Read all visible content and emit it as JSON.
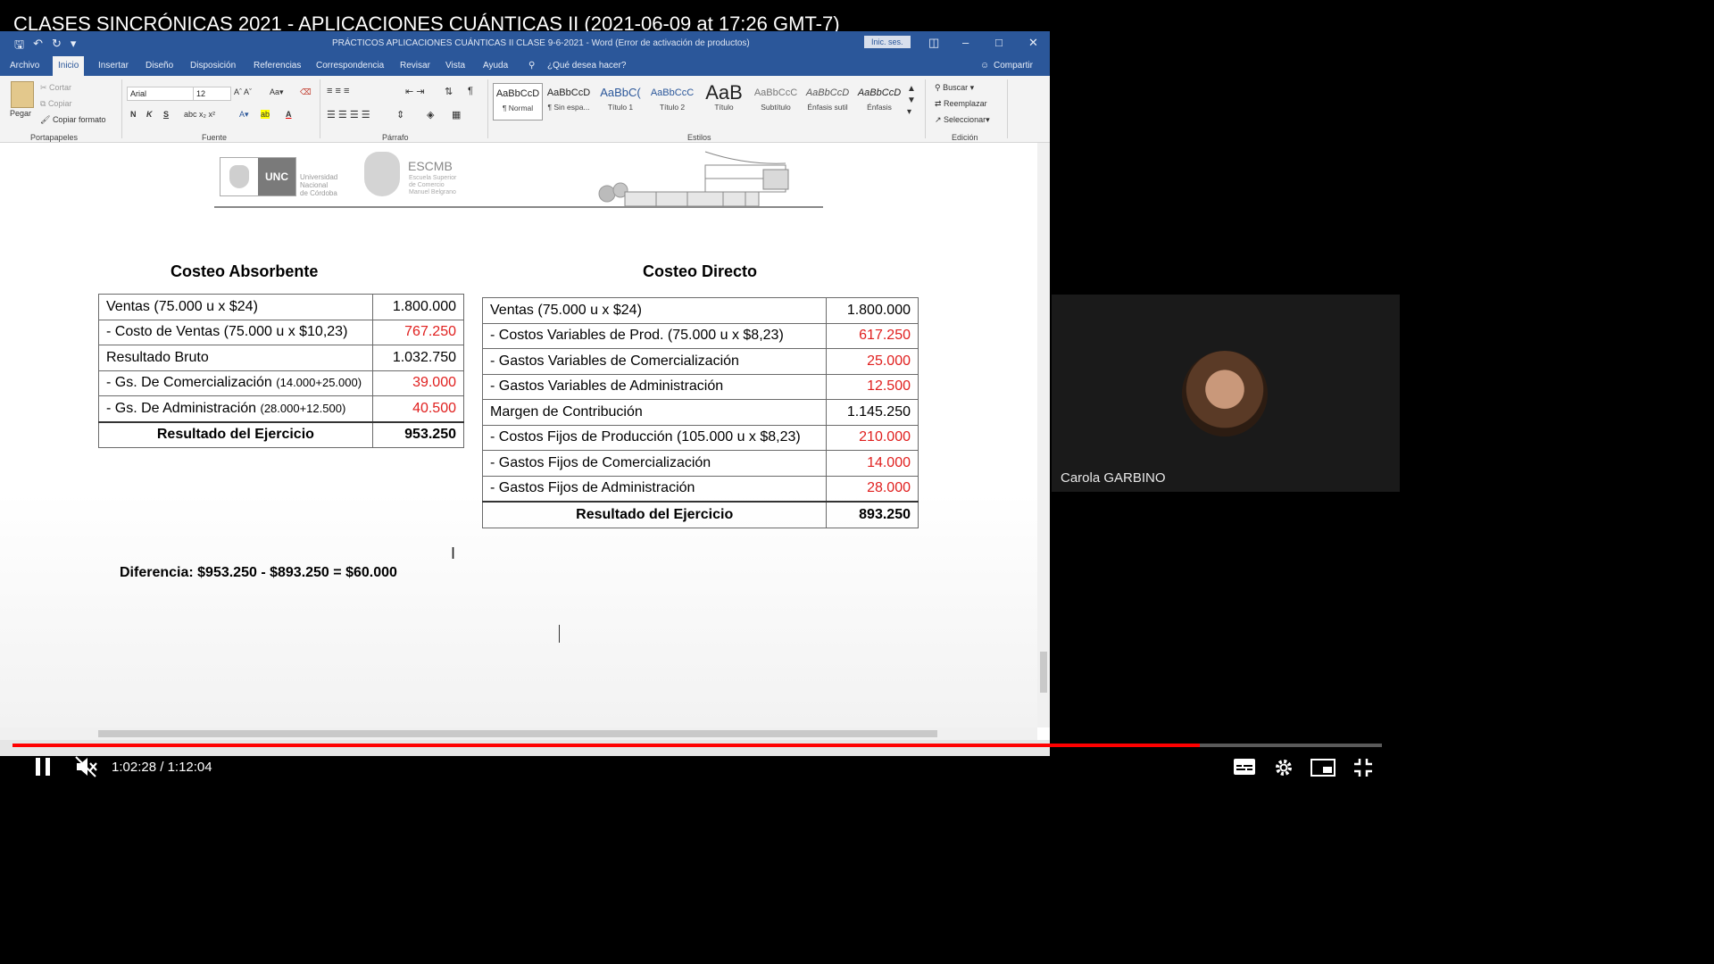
{
  "video": {
    "title": "CLASES SINCRÓNICAS 2021 - APLICACIONES CUÁNTICAS II (2021-06-09 at 17:26 GMT-7)",
    "time_current": "1:02:28",
    "time_sep": " / ",
    "time_total": "1:12:04",
    "progress": 0.867
  },
  "word": {
    "doc_title": "PRÁCTICOS APLICACIONES CUÁNTICAS II  CLASE 9-6-2021  -  Word (Error de activación de productos)",
    "signin": "Inic. ses.",
    "tabs": [
      "Archivo",
      "Inicio",
      "Insertar",
      "Diseño",
      "Disposición",
      "Referencias",
      "Correspondencia",
      "Revisar",
      "Vista",
      "Ayuda"
    ],
    "tell_me": "¿Qué desea hacer?",
    "share": "Compartir",
    "clipboard": {
      "paste": "Pegar",
      "cut": "Cortar",
      "copy": "Copiar",
      "format": "Copiar formato",
      "label": "Portapapeles"
    },
    "font": {
      "name": "Arial",
      "size": "12",
      "label": "Fuente",
      "bold": "N",
      "italic": "K",
      "underline": "S"
    },
    "paragraph": {
      "label": "Párrafo"
    },
    "styles": {
      "label": "Estilos",
      "items": [
        {
          "sample": "AaBbCcD",
          "name": "¶ Normal"
        },
        {
          "sample": "AaBbCcD",
          "name": "¶ Sin espa..."
        },
        {
          "sample": "AaBbC(",
          "name": "Título 1"
        },
        {
          "sample": "AaBbCcC",
          "name": "Título 2"
        },
        {
          "sample": "AaB",
          "name": "Título"
        },
        {
          "sample": "AaBbCcC",
          "name": "Subtítulo"
        },
        {
          "sample": "AaBbCcD",
          "name": "Énfasis sutil"
        },
        {
          "sample": "AaBbCcD",
          "name": "Énfasis"
        }
      ]
    },
    "editing": {
      "find": "Buscar",
      "replace": "Reemplazar",
      "select": "Seleccionar",
      "label": "Edición"
    }
  },
  "document": {
    "logos": {
      "unc": "UNC",
      "unc_sub": [
        "Universidad",
        "Nacional",
        "de Córdoba"
      ],
      "escmb": "ESCMB",
      "escmb_sub": [
        "Escuela Superior",
        "de Comercio",
        "Manuel Belgrano"
      ]
    },
    "absorbente": {
      "heading": "Costeo Absorbente",
      "rows": [
        {
          "label": "Ventas (75.000 u x $24)",
          "note": "",
          "value": "1.800.000",
          "neg": false
        },
        {
          "label": "- Costo de Ventas (75.000 u x $10,23)",
          "note": "",
          "value": "767.250",
          "neg": true
        },
        {
          "label": "Resultado Bruto",
          "note": "",
          "value": "1.032.750",
          "neg": false
        },
        {
          "label": "- Gs. De Comercialización ",
          "note": "(14.000+25.000)",
          "value": "39.000",
          "neg": true
        },
        {
          "label": "- Gs. De Administración ",
          "note": "(28.000+12.500)",
          "value": "40.500",
          "neg": true
        }
      ],
      "total_label": "Resultado del Ejercicio",
      "total_value": "953.250"
    },
    "directo": {
      "heading": "Costeo Directo",
      "rows": [
        {
          "label": "Ventas (75.000 u x $24)",
          "value": "1.800.000",
          "neg": false
        },
        {
          "label": "- Costos Variables de Prod. (75.000 u x $8,23)",
          "value": "617.250",
          "neg": true
        },
        {
          "label": "- Gastos Variables de Comercialización",
          "value": "25.000",
          "neg": true
        },
        {
          "label": "- Gastos Variables de Administración",
          "value": "12.500",
          "neg": true
        },
        {
          "label": "Margen de Contribución",
          "value": "1.145.250",
          "neg": false
        },
        {
          "label": "- Costos Fijos de Producción (105.000 u x $8,23)",
          "value": "210.000",
          "neg": true
        },
        {
          "label": "- Gastos Fijos de Comercialización",
          "value": "14.000",
          "neg": true
        },
        {
          "label": "- Gastos Fijos de Administración",
          "value": "28.000",
          "neg": true
        }
      ],
      "total_label": "Resultado del Ejercicio",
      "total_value": "893.250"
    },
    "difference": "Diferencia: $953.250 - $893.250 = $60.000"
  },
  "participant": {
    "name": "Carola GARBINO"
  },
  "colors": {
    "word_blue": "#2b579a",
    "negative_red": "#e0201f",
    "progress_red": "#ff0000"
  }
}
